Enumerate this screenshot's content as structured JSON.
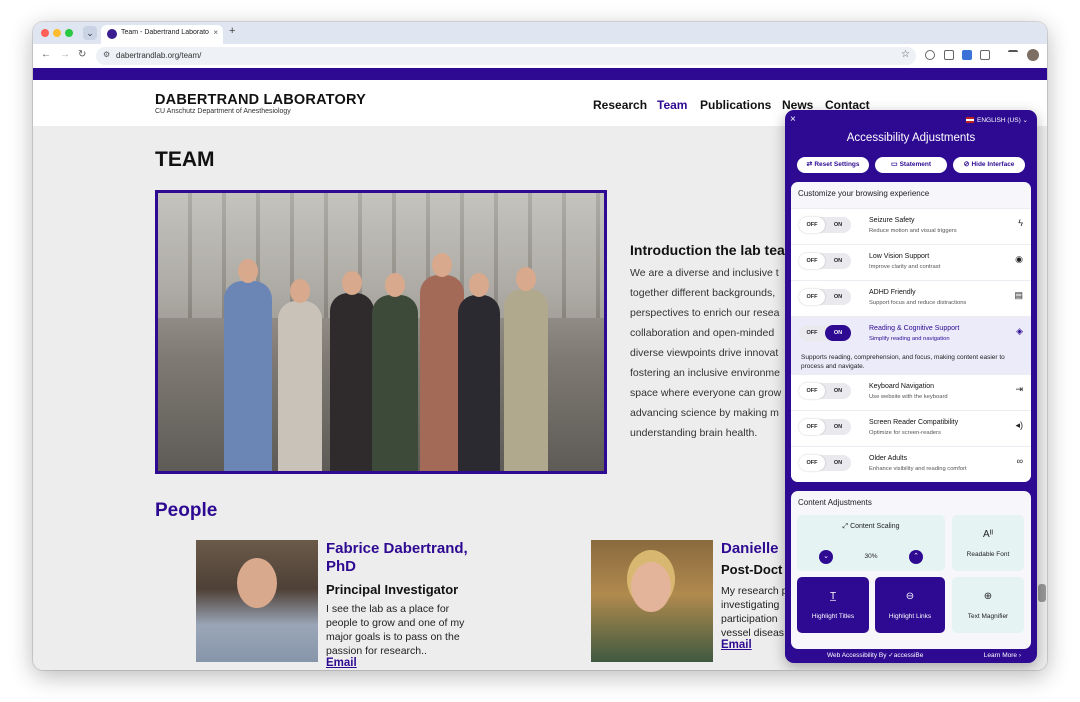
{
  "browser": {
    "tab_title": "Team - Dabertrand Laboratory",
    "tab_close": "×",
    "new_tab": "+",
    "tab_list": "⌄",
    "url": "dabertrandlab.org/team/",
    "nav_back": "←",
    "nav_forward": "→",
    "nav_reload": "↻",
    "bookmark": "☆"
  },
  "site": {
    "logo_title": "DABERTRAND LABORATORY",
    "logo_subtitle": "CU Anschutz Department of Anesthesiology",
    "nav": [
      "Research",
      "Team",
      "Publications",
      "News",
      "Contact"
    ],
    "active_nav": "Team",
    "accent_color": "#2e0a92"
  },
  "page": {
    "heading": "TEAM",
    "intro_title": "Introduction the lab tea",
    "intro_lines": [
      "We are a diverse and inclusive t",
      "together different backgrounds,",
      "perspectives to enrich our resea",
      "collaboration and open-minded",
      "diverse viewpoints drive innovat",
      "fostering an inclusive environme",
      "space where everyone can grow",
      "advancing science by making m",
      "understanding brain health."
    ],
    "people_heading": "People",
    "people": [
      {
        "name_line1": "Fabrice Dabertrand,",
        "name_line2": "PhD",
        "role": "Principal Investigator",
        "bio": [
          "I see the lab as a place for",
          "people to grow and one of my",
          "major goals is to pass on the",
          "passion for research.."
        ],
        "link": "Email"
      },
      {
        "name_line1": "Danielle",
        "name_line2": "",
        "role": "Post-Doct",
        "bio": [
          "My research p",
          "investigating",
          "participation",
          "vessel diseas"
        ],
        "link": "Email"
      }
    ]
  },
  "accessibility": {
    "close": "×",
    "language": "ENGLISH (US)",
    "title": "Accessibility Adjustments",
    "buttons": [
      {
        "icon": "⇄",
        "label": "Reset Settings"
      },
      {
        "icon": "▭",
        "label": "Statement"
      },
      {
        "icon": "⊘",
        "label": "Hide Interface"
      }
    ],
    "profiles_heading": "Customize your browsing experience",
    "toggle_off": "OFF",
    "toggle_on": "ON",
    "profiles": [
      {
        "name": "Seizure Safety",
        "desc": "Reduce motion and visual triggers",
        "icon": "ϟ",
        "on": false
      },
      {
        "name": "Low Vision Support",
        "desc": "Improve clarity and contrast",
        "icon": "◉",
        "on": false
      },
      {
        "name": "ADHD Friendly",
        "desc": "Support focus and reduce distractions",
        "icon": "▤",
        "on": false
      },
      {
        "name": "Reading & Cognitive Support",
        "desc": "Simplify reading and navigation",
        "icon": "◈",
        "on": true,
        "extra": "Supports reading, comprehension, and focus, making content easier to process and navigate."
      },
      {
        "name": "Keyboard Navigation",
        "desc": "Use website with the keyboard",
        "icon": "⇥",
        "on": false
      },
      {
        "name": "Screen Reader Compatibility",
        "desc": "Optimize for screen-readers",
        "icon": "◂)",
        "on": false
      },
      {
        "name": "Older Adults",
        "desc": "Enhance visibility and reading comfort",
        "icon": "∞",
        "on": false
      }
    ],
    "content_heading": "Content Adjustments",
    "scaling_label": "Content Scaling",
    "scaling_value": "30%",
    "scaling_down": "⌄",
    "scaling_up": "⌃",
    "tiles": [
      {
        "icon": "Aᴵᴵ",
        "label": "Readable Font"
      },
      {
        "icon": "T̲",
        "label": "Highlight Titles"
      },
      {
        "icon": "⊖",
        "label": "Highlight Links"
      },
      {
        "icon": "⊕",
        "label": "Text Magnifier"
      }
    ],
    "footer_left": "Web Accessibility By ✓accessiBe",
    "footer_right": "Learn More ›"
  }
}
